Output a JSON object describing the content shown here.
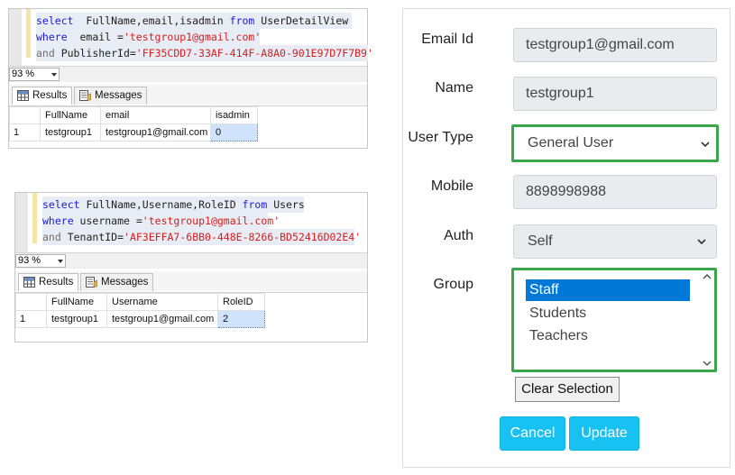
{
  "query1": {
    "line1": [
      "select",
      "  FullName,email,isadmin ",
      "from",
      " UserDetailView"
    ],
    "line2": [
      "where",
      "  email =",
      "'testgroup1@gmail.com'"
    ],
    "line3": [
      "and",
      " PublisherId=",
      "'FF35CDD7-33AF-414F-A8A0-901E97D7F7B9'"
    ],
    "zoom": "93 %",
    "tabs": [
      "Results",
      "Messages"
    ],
    "columns": [
      "FullName",
      "email",
      "isadmin"
    ],
    "rows": [
      [
        "1",
        "testgroup1",
        "testgroup1@gmail.com",
        "0"
      ]
    ]
  },
  "query2": {
    "line1": [
      "select",
      " FullName,Username,RoleID ",
      "from",
      " Users"
    ],
    "line2": [
      "where",
      " username =",
      "'testgroup1@gmail.com'"
    ],
    "line3": [
      "and",
      " TenantID=",
      "'AF3EFFA7-6BB0-448E-8266-BD52416D02E4'"
    ],
    "zoom": "93 %",
    "tabs": [
      "Results",
      "Messages"
    ],
    "columns": [
      "FullName",
      "Username",
      "RoleID"
    ],
    "rows": [
      [
        "1",
        "testgroup1",
        "testgroup1@gmail.com",
        "2"
      ]
    ]
  },
  "form": {
    "email_label": "Email Id",
    "email_value": "testgroup1@gmail.com",
    "name_label": "Name",
    "name_value": "testgroup1",
    "usertype_label": "User Type",
    "usertype_value": "General User",
    "mobile_label": "Mobile",
    "mobile_value": "8898998988",
    "auth_label": "Auth",
    "auth_value": "Self",
    "group_label": "Group",
    "group_options": [
      "Staff",
      "Students",
      "Teachers"
    ],
    "group_selected": "Staff",
    "clear_label": "Clear Selection",
    "cancel_label": "Cancel",
    "update_label": "Update"
  },
  "colors": {
    "highlight_border": "#3aa64a",
    "primary_button": "#17c1f1",
    "selection": "#0078d7"
  }
}
